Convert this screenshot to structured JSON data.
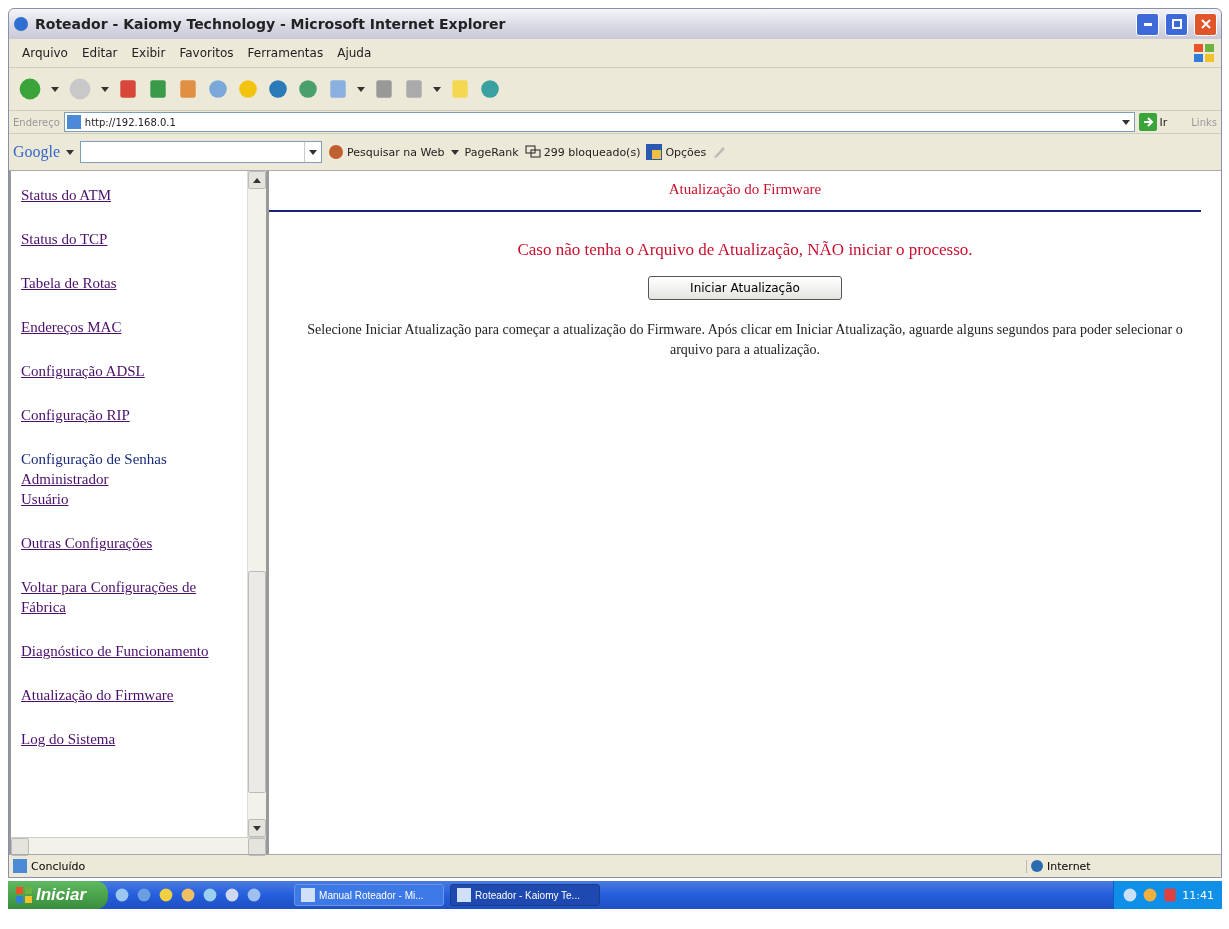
{
  "window": {
    "title": "Roteador - Kaiomy Technology - Microsoft Internet Explorer"
  },
  "menu": [
    "Arquivo",
    "Editar",
    "Exibir",
    "Favoritos",
    "Ferramentas",
    "Ajuda"
  ],
  "address_bar": {
    "label": "Endereço",
    "value": "http://192.168.0.1",
    "go": "Ir",
    "links": "Links"
  },
  "google_bar": {
    "logo": "Google",
    "search_button": "Pesquisar na Web",
    "pagerank": "PageRank",
    "blocked": "299 bloqueado(s)",
    "options": "Opções"
  },
  "sidebar": {
    "items": [
      {
        "label": "Status do ATM",
        "kind": "link"
      },
      {
        "label": "Status do TCP",
        "kind": "link"
      },
      {
        "label": "Tabela de Rotas",
        "kind": "link"
      },
      {
        "label": "Endereços MAC",
        "kind": "link"
      },
      {
        "label": "Configuração ADSL",
        "kind": "link"
      },
      {
        "label": "Configuração RIP",
        "kind": "link"
      },
      {
        "label": "Configuração de Senhas",
        "kind": "heading",
        "children": [
          {
            "label": "Administrador",
            "kind": "link"
          },
          {
            "label": "Usuário",
            "kind": "link"
          }
        ]
      },
      {
        "label": "Outras Configurações",
        "kind": "link"
      },
      {
        "label": "Voltar para Configurações de Fábrica",
        "kind": "link"
      },
      {
        "label": "Diagnóstico de Funcionamento",
        "kind": "link"
      },
      {
        "label": "Atualização do Firmware",
        "kind": "link"
      },
      {
        "label": "Log do Sistema",
        "kind": "link"
      }
    ]
  },
  "content": {
    "title": "Atualização do Firmware",
    "warning": "Caso não tenha o Arquivo de Atualização, NÃO iniciar o processo.",
    "button": "Iniciar Atualização",
    "description": "Selecione Iniciar Atualização para começar a atualização do Firmware. Após clicar em Iniciar Atualização, aguarde alguns segundos para poder selecionar o arquivo para a atualização."
  },
  "status_bar": {
    "text": "Concluído",
    "zone": "Internet"
  },
  "taskbar": {
    "start": "Iniciar",
    "tasks": [
      {
        "label": "Manual Roteador - Mi...",
        "selected": false
      },
      {
        "label": "Roteador - Kaiomy Te...",
        "selected": true
      }
    ],
    "clock": "11:41"
  }
}
